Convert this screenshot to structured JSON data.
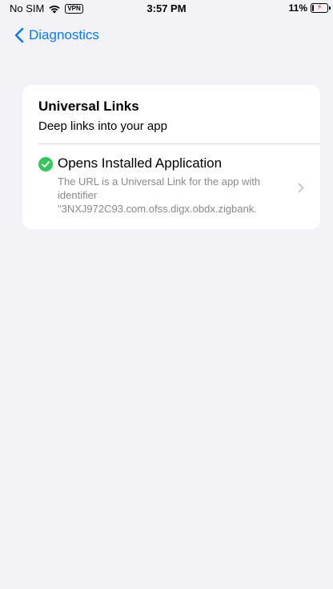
{
  "status_bar": {
    "carrier": "No SIM",
    "vpn_label": "VPN",
    "time": "3:57 PM",
    "battery_percent": "11%",
    "battery_level": 0.11,
    "charging": true,
    "icons": [
      "wifi-icon",
      "vpn-badge",
      "battery-icon",
      "charging-bolt-icon"
    ]
  },
  "nav": {
    "back_label": "Diagnostics",
    "back_icon": "chevron-left-icon",
    "accent_color": "#0a7aff"
  },
  "section": {
    "title": "Universal Links",
    "subtitle": "Deep links into your app"
  },
  "result": {
    "status_icon": "checkmark-circle-icon",
    "status_color": "#34c759",
    "title": "Opens Installed Application",
    "description": "The URL is a Universal Link for the app with identifier",
    "identifier": "\"3NXJ972C93.com.ofss.digx.obdx.zigbank.",
    "disclosure_icon": "chevron-right-icon"
  }
}
